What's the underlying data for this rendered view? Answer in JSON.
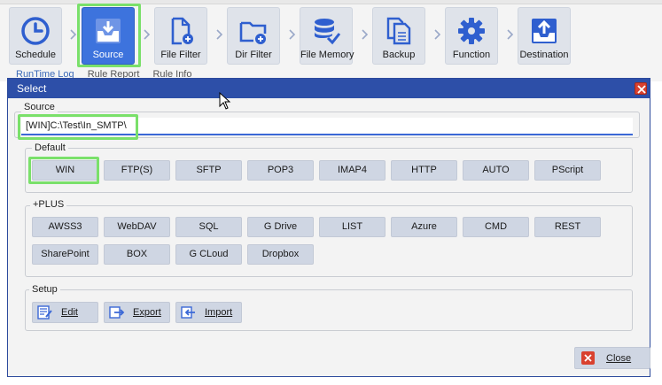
{
  "toolbar": {
    "items": [
      {
        "label": "Schedule",
        "icon": "clock-icon"
      },
      {
        "label": "Source",
        "icon": "download-tray-icon",
        "active": true
      },
      {
        "label": "File Filter",
        "icon": "file-add-icon"
      },
      {
        "label": "Dir Filter",
        "icon": "folder-add-icon"
      },
      {
        "label": "File Memory",
        "icon": "database-check-icon"
      },
      {
        "label": "Backup",
        "icon": "copy-files-icon"
      },
      {
        "label": "Function",
        "icon": "gear-icon"
      },
      {
        "label": "Destination",
        "icon": "upload-tray-icon"
      }
    ],
    "accent": "#3d73dd"
  },
  "subtabs": {
    "runtime_log": "RunTime Log",
    "rule_report": "Rule Report",
    "rule_info": "Rule Info"
  },
  "dialog": {
    "title": "Select",
    "title_color": "#2d4fa8",
    "source_group": "Source",
    "path_value": "[WIN]C:\\Test\\In_SMTP\\",
    "default_group": "Default",
    "default_buttons": [
      "WIN",
      "FTP(S)",
      "SFTP",
      "POP3",
      "IMAP4",
      "HTTP",
      "AUTO",
      "PScript"
    ],
    "plus_group": "+PLUS",
    "plus_buttons_row1": [
      "AWSS3",
      "WebDAV",
      "SQL",
      "G Drive",
      "LIST",
      "Azure",
      "CMD",
      "REST"
    ],
    "plus_buttons_row2": [
      "SharePoint",
      "BOX",
      "G CLoud",
      "Dropbox"
    ],
    "setup_group": "Setup",
    "setup": {
      "edit": "Edit",
      "export": "Export",
      "import": "Import"
    },
    "close_label": "Close"
  },
  "highlight_color": "#7ae06a"
}
